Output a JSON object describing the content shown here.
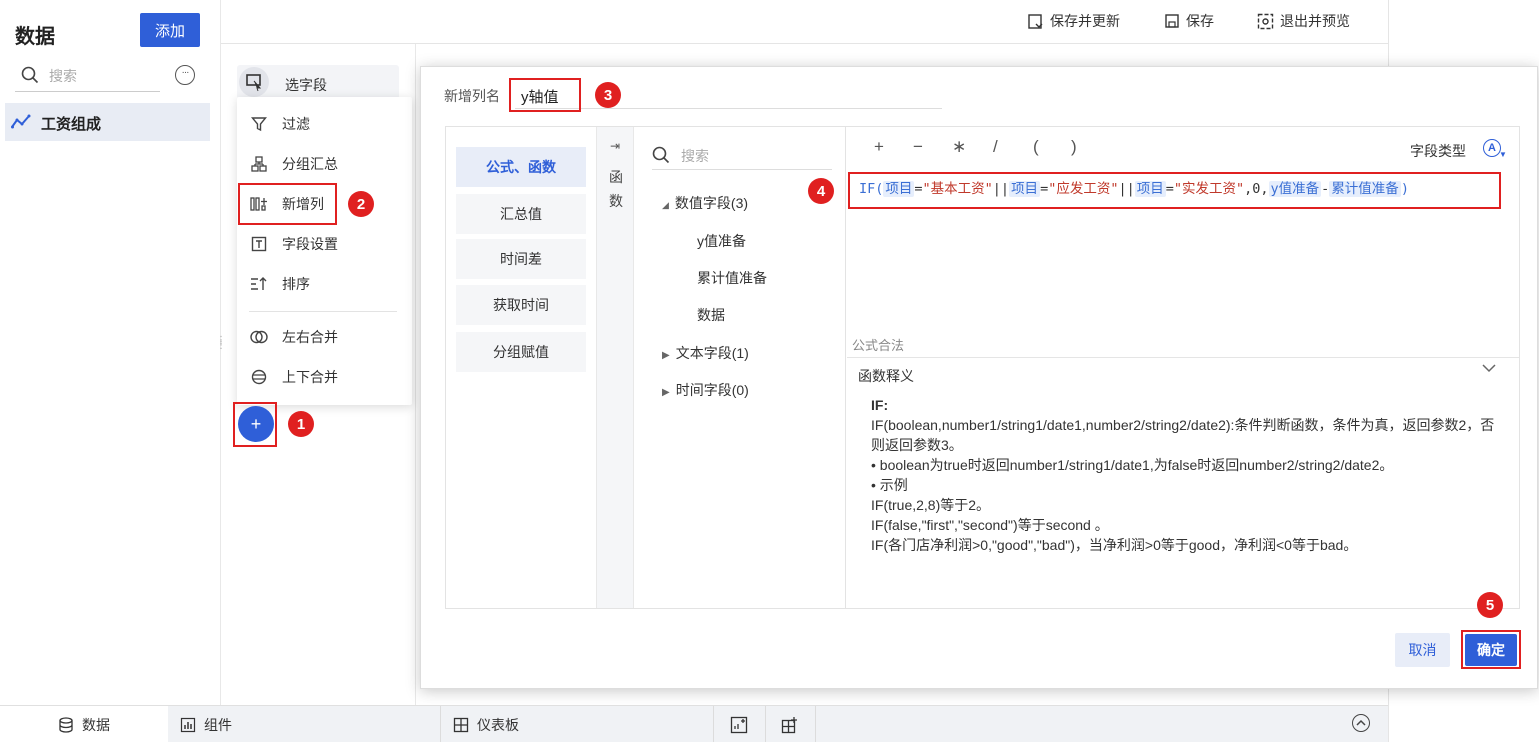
{
  "left_panel": {
    "title": "数据",
    "add_label": "添加",
    "search_placeholder": "搜索",
    "dataset_name": "工资组成"
  },
  "toolbar": {
    "save_update": "保存并更新",
    "save": "保存",
    "exit_preview": "退出并预览"
  },
  "steps": {
    "select_field": "选字段"
  },
  "menu": {
    "items": [
      {
        "label": "过滤",
        "icon": "filter-icon"
      },
      {
        "label": "分组汇总",
        "icon": "group-icon"
      },
      {
        "label": "新增列",
        "icon": "add-column-icon"
      },
      {
        "label": "字段设置",
        "icon": "field-settings-icon"
      },
      {
        "label": "排序",
        "icon": "sort-icon"
      },
      {
        "label": "左右合并",
        "icon": "merge-lr-icon"
      },
      {
        "label": "上下合并",
        "icon": "merge-ud-icon"
      }
    ]
  },
  "plus_label": "+",
  "badges": [
    "1",
    "2",
    "3",
    "4",
    "5"
  ],
  "dialog": {
    "column_name_label": "新增列名",
    "column_name_value": "y轴值",
    "categories": [
      "公式、函数",
      "汇总值",
      "时间差",
      "获取时间",
      "分组赋值"
    ],
    "fn_strip_text": "函数",
    "field_search_placeholder": "搜索",
    "tree": {
      "numeric": "数值字段(3)",
      "numeric_items": [
        "y值准备",
        "累计值准备",
        "数据"
      ],
      "text": "文本字段(1)",
      "time": "时间字段(0)"
    },
    "operators": [
      "+",
      "−",
      "∗",
      "/",
      "(",
      ")"
    ],
    "field_type_label": "字段类型",
    "field_type_icon": "A",
    "formula_tokens": [
      {
        "t": "fn",
        "v": "IF("
      },
      {
        "t": "field",
        "v": "项目"
      },
      {
        "t": "op",
        "v": "="
      },
      {
        "t": "str",
        "v": "\"基本工资\""
      },
      {
        "t": "op",
        "v": "||"
      },
      {
        "t": "field",
        "v": "项目"
      },
      {
        "t": "op",
        "v": "="
      },
      {
        "t": "str",
        "v": "\"应发工资\""
      },
      {
        "t": "op",
        "v": "||"
      },
      {
        "t": "field",
        "v": "项目"
      },
      {
        "t": "op",
        "v": "="
      },
      {
        "t": "str",
        "v": "\"实发工资\""
      },
      {
        "t": "op",
        "v": ",0,"
      },
      {
        "t": "field",
        "v": "y值准备"
      },
      {
        "t": "op",
        "v": "-"
      },
      {
        "t": "field",
        "v": "累计值准备"
      },
      {
        "t": "fn",
        "v": ")"
      }
    ],
    "valid_text": "公式合法",
    "fn_explain_title": "函数释义",
    "fn_desc": {
      "title": "IF:",
      "lines": [
        "IF(boolean,number1/string1/date1,number2/string2/date2):条件判断函数，条件为真，返回参数2，否则返回参数3。",
        "• boolean为true时返回number1/string1/date1,为false时返回number2/string2/date2。",
        "• 示例",
        "IF(true,2,8)等于2。",
        "IF(false,\"first\",\"second\")等于second 。",
        "IF(各门店净利润>0,\"good\",\"bad\")，当净利润>0等于good，净利润<0等于bad。"
      ]
    },
    "cancel_label": "取消",
    "ok_label": "确定"
  },
  "bottom_bar": {
    "data_tab": "数据",
    "component_tab": "组件",
    "dashboard_tab": "仪表板"
  }
}
